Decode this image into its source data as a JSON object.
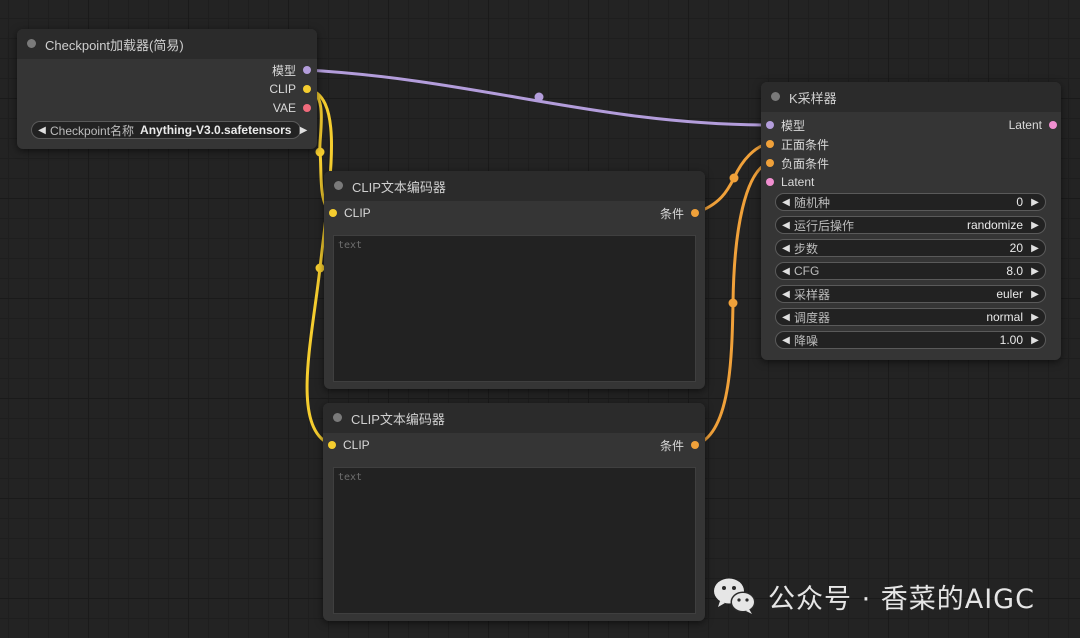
{
  "checkpoint_node": {
    "title": "Checkpoint加载器(简易)",
    "outputs": [
      "模型",
      "CLIP",
      "VAE"
    ],
    "widget": {
      "label": "Checkpoint名称",
      "value": "Anything-V3.0.safetensors"
    }
  },
  "clip_node_1": {
    "title": "CLIP文本编码器",
    "input": "CLIP",
    "output": "条件",
    "placeholder": "text"
  },
  "clip_node_2": {
    "title": "CLIP文本编码器",
    "input": "CLIP",
    "output": "条件",
    "placeholder": "text"
  },
  "ksampler_node": {
    "title": "K采样器",
    "inputs": [
      "模型",
      "正面条件",
      "负面条件",
      "Latent"
    ],
    "output": "Latent",
    "widgets": [
      {
        "label": "随机种",
        "value": "0"
      },
      {
        "label": "运行后操作",
        "value": "randomize"
      },
      {
        "label": "步数",
        "value": "20"
      },
      {
        "label": "CFG",
        "value": "8.0"
      },
      {
        "label": "采样器",
        "value": "euler"
      },
      {
        "label": "调度器",
        "value": "normal"
      },
      {
        "label": "降噪",
        "value": "1.00"
      }
    ]
  },
  "slot_colors": {
    "model": "#b39ddb",
    "clip": "#f5cd2f",
    "vae": "#f06b7c",
    "conditioning": "#f0a13a",
    "latent": "#f08fd0"
  },
  "arrows": {
    "left": "◀",
    "right": "▶"
  },
  "watermark": {
    "icon": "wechat-icon",
    "text": "公众号 · 香菜的AIGC"
  }
}
